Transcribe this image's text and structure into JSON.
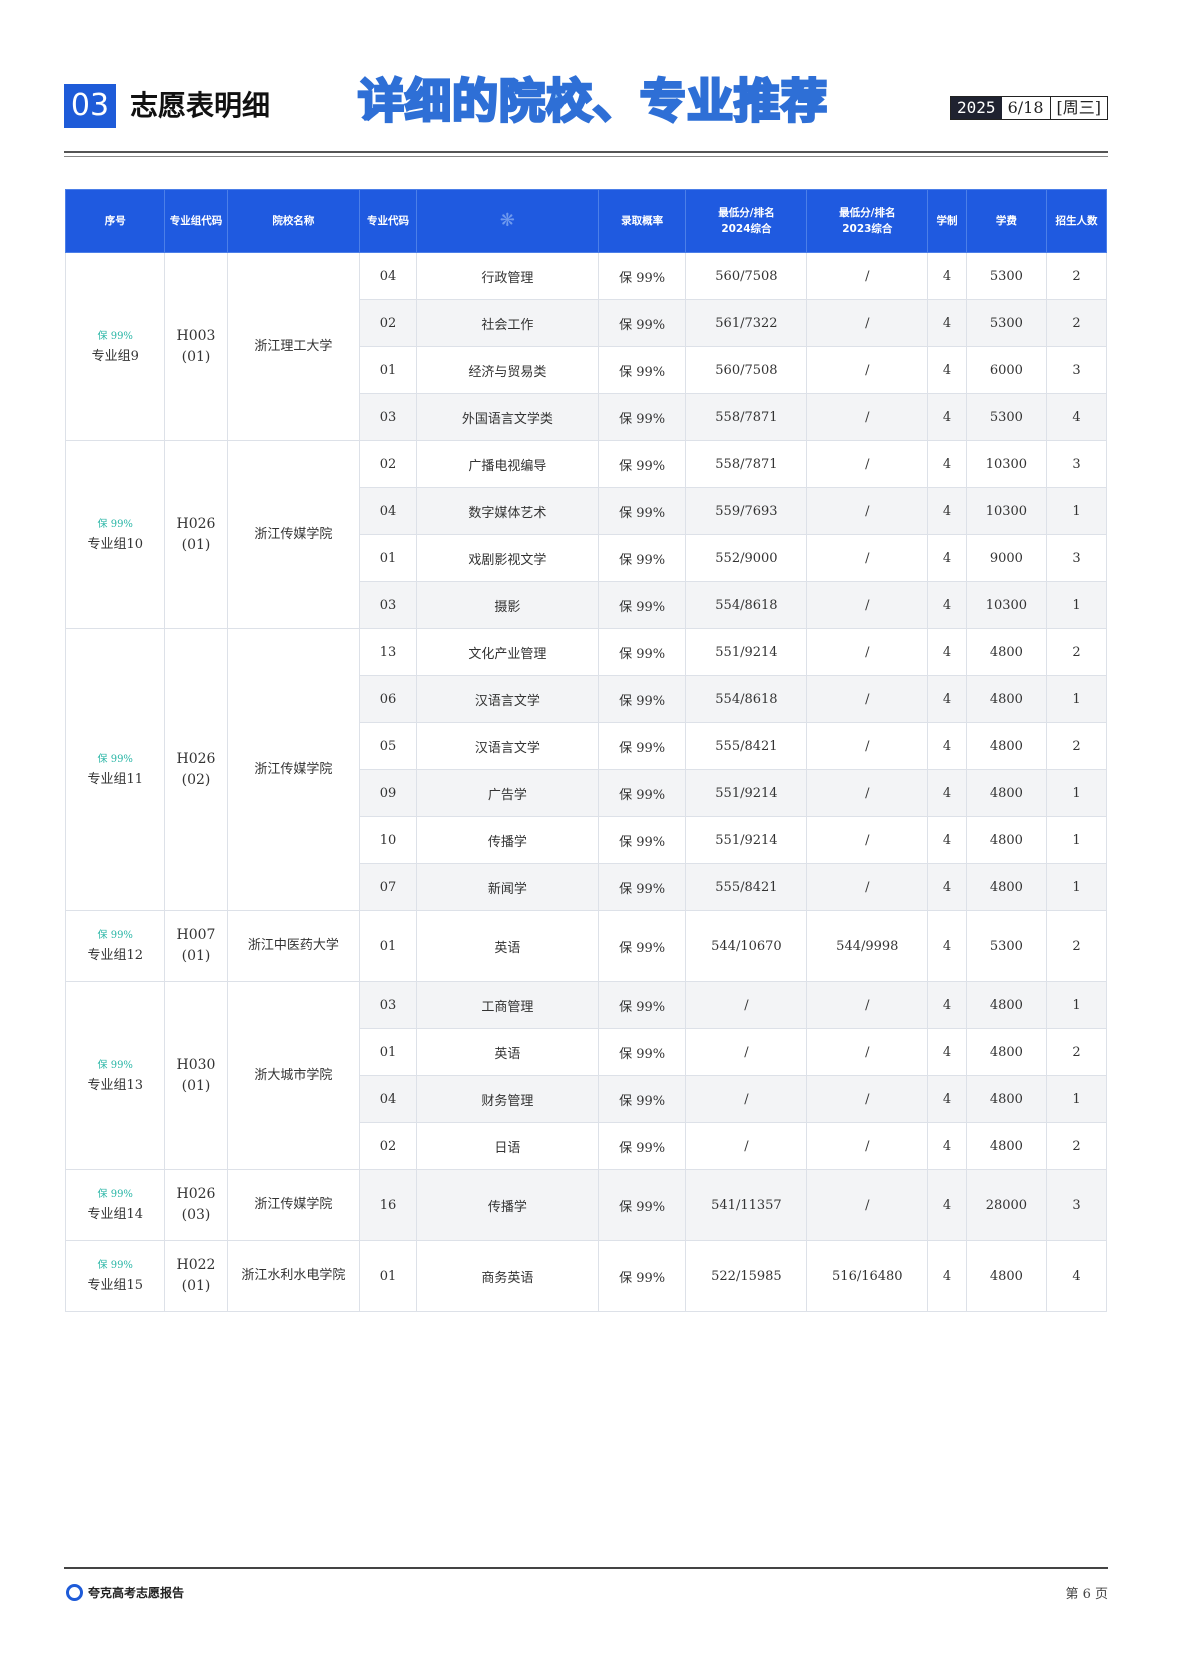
{
  "header": {
    "section_number": "03",
    "section_title": "志愿表明细",
    "banner": "详细的院校、专业推荐",
    "date_year": "2025",
    "date_day": "6/18",
    "date_week": "[周三]"
  },
  "table": {
    "columns": [
      "序号",
      "专业组代码",
      "院校名称",
      "专业代码",
      "",
      "录取概率",
      "最低分/排名\n2024综合",
      "最低分/排名\n2023综合",
      "学制",
      "学费",
      "招生人数"
    ],
    "groups": [
      {
        "badge": "保 99%",
        "group_name": "专业组9",
        "group_code": "H003",
        "group_sub": "(01)",
        "school": "浙江理工大学",
        "majors": [
          {
            "code": "04",
            "name": "行政管理",
            "prob": "保 99%",
            "s2024": "560/7508",
            "s2023": "/",
            "years": "4",
            "fee": "5300",
            "quota": "2"
          },
          {
            "code": "02",
            "name": "社会工作",
            "prob": "保 99%",
            "s2024": "561/7322",
            "s2023": "/",
            "years": "4",
            "fee": "5300",
            "quota": "2"
          },
          {
            "code": "01",
            "name": "经济与贸易类",
            "prob": "保 99%",
            "s2024": "560/7508",
            "s2023": "/",
            "years": "4",
            "fee": "6000",
            "quota": "3"
          },
          {
            "code": "03",
            "name": "外国语言文学类",
            "prob": "保 99%",
            "s2024": "558/7871",
            "s2023": "/",
            "years": "4",
            "fee": "5300",
            "quota": "4"
          }
        ]
      },
      {
        "badge": "保 99%",
        "group_name": "专业组10",
        "group_code": "H026",
        "group_sub": "(01)",
        "school": "浙江传媒学院",
        "majors": [
          {
            "code": "02",
            "name": "广播电视编导",
            "prob": "保 99%",
            "s2024": "558/7871",
            "s2023": "/",
            "years": "4",
            "fee": "10300",
            "quota": "3"
          },
          {
            "code": "04",
            "name": "数字媒体艺术",
            "prob": "保 99%",
            "s2024": "559/7693",
            "s2023": "/",
            "years": "4",
            "fee": "10300",
            "quota": "1"
          },
          {
            "code": "01",
            "name": "戏剧影视文学",
            "prob": "保 99%",
            "s2024": "552/9000",
            "s2023": "/",
            "years": "4",
            "fee": "9000",
            "quota": "3"
          },
          {
            "code": "03",
            "name": "摄影",
            "prob": "保 99%",
            "s2024": "554/8618",
            "s2023": "/",
            "years": "4",
            "fee": "10300",
            "quota": "1"
          }
        ]
      },
      {
        "badge": "保 99%",
        "group_name": "专业组11",
        "group_code": "H026",
        "group_sub": "(02)",
        "school": "浙江传媒学院",
        "majors": [
          {
            "code": "13",
            "name": "文化产业管理",
            "prob": "保 99%",
            "s2024": "551/9214",
            "s2023": "/",
            "years": "4",
            "fee": "4800",
            "quota": "2"
          },
          {
            "code": "06",
            "name": "汉语言文学",
            "prob": "保 99%",
            "s2024": "554/8618",
            "s2023": "/",
            "years": "4",
            "fee": "4800",
            "quota": "1"
          },
          {
            "code": "05",
            "name": "汉语言文学",
            "prob": "保 99%",
            "s2024": "555/8421",
            "s2023": "/",
            "years": "4",
            "fee": "4800",
            "quota": "2"
          },
          {
            "code": "09",
            "name": "广告学",
            "prob": "保 99%",
            "s2024": "551/9214",
            "s2023": "/",
            "years": "4",
            "fee": "4800",
            "quota": "1"
          },
          {
            "code": "10",
            "name": "传播学",
            "prob": "保 99%",
            "s2024": "551/9214",
            "s2023": "/",
            "years": "4",
            "fee": "4800",
            "quota": "1"
          },
          {
            "code": "07",
            "name": "新闻学",
            "prob": "保 99%",
            "s2024": "555/8421",
            "s2023": "/",
            "years": "4",
            "fee": "4800",
            "quota": "1"
          }
        ]
      },
      {
        "badge": "保 99%",
        "group_name": "专业组12",
        "group_code": "H007",
        "group_sub": "(01)",
        "school": "浙江中医药大学",
        "majors": [
          {
            "code": "01",
            "name": "英语",
            "prob": "保 99%",
            "s2024": "544/10670",
            "s2023": "544/9998",
            "years": "4",
            "fee": "5300",
            "quota": "2"
          }
        ]
      },
      {
        "badge": "保 99%",
        "group_name": "专业组13",
        "group_code": "H030",
        "group_sub": "(01)",
        "school": "浙大城市学院",
        "majors": [
          {
            "code": "03",
            "name": "工商管理",
            "prob": "保 99%",
            "s2024": "/",
            "s2023": "/",
            "years": "4",
            "fee": "4800",
            "quota": "1"
          },
          {
            "code": "01",
            "name": "英语",
            "prob": "保 99%",
            "s2024": "/",
            "s2023": "/",
            "years": "4",
            "fee": "4800",
            "quota": "2"
          },
          {
            "code": "04",
            "name": "财务管理",
            "prob": "保 99%",
            "s2024": "/",
            "s2023": "/",
            "years": "4",
            "fee": "4800",
            "quota": "1"
          },
          {
            "code": "02",
            "name": "日语",
            "prob": "保 99%",
            "s2024": "/",
            "s2023": "/",
            "years": "4",
            "fee": "4800",
            "quota": "2"
          }
        ]
      },
      {
        "badge": "保 99%",
        "group_name": "专业组14",
        "group_code": "H026",
        "group_sub": "(03)",
        "school": "浙江传媒学院",
        "majors": [
          {
            "code": "16",
            "name": "传播学",
            "prob": "保 99%",
            "s2024": "541/11357",
            "s2023": "/",
            "years": "4",
            "fee": "28000",
            "quota": "3"
          }
        ]
      },
      {
        "badge": "保 99%",
        "group_name": "专业组15",
        "group_code": "H022",
        "group_sub": "(01)",
        "school": "浙江水利水电学院",
        "majors": [
          {
            "code": "01",
            "name": "商务英语",
            "prob": "保 99%",
            "s2024": "522/15985",
            "s2023": "516/16480",
            "years": "4",
            "fee": "4800",
            "quota": "4"
          }
        ]
      }
    ]
  },
  "footer": {
    "brand": "夸克高考志愿报告",
    "page_label": "第 6 页"
  },
  "icons": {
    "header_col5": "crest-icon",
    "footer_logo": "quark-logo-icon"
  },
  "colors": {
    "accent": "#1e5bd8",
    "header_bg": "#1f5ae0",
    "badge": "#2ab6a6"
  }
}
